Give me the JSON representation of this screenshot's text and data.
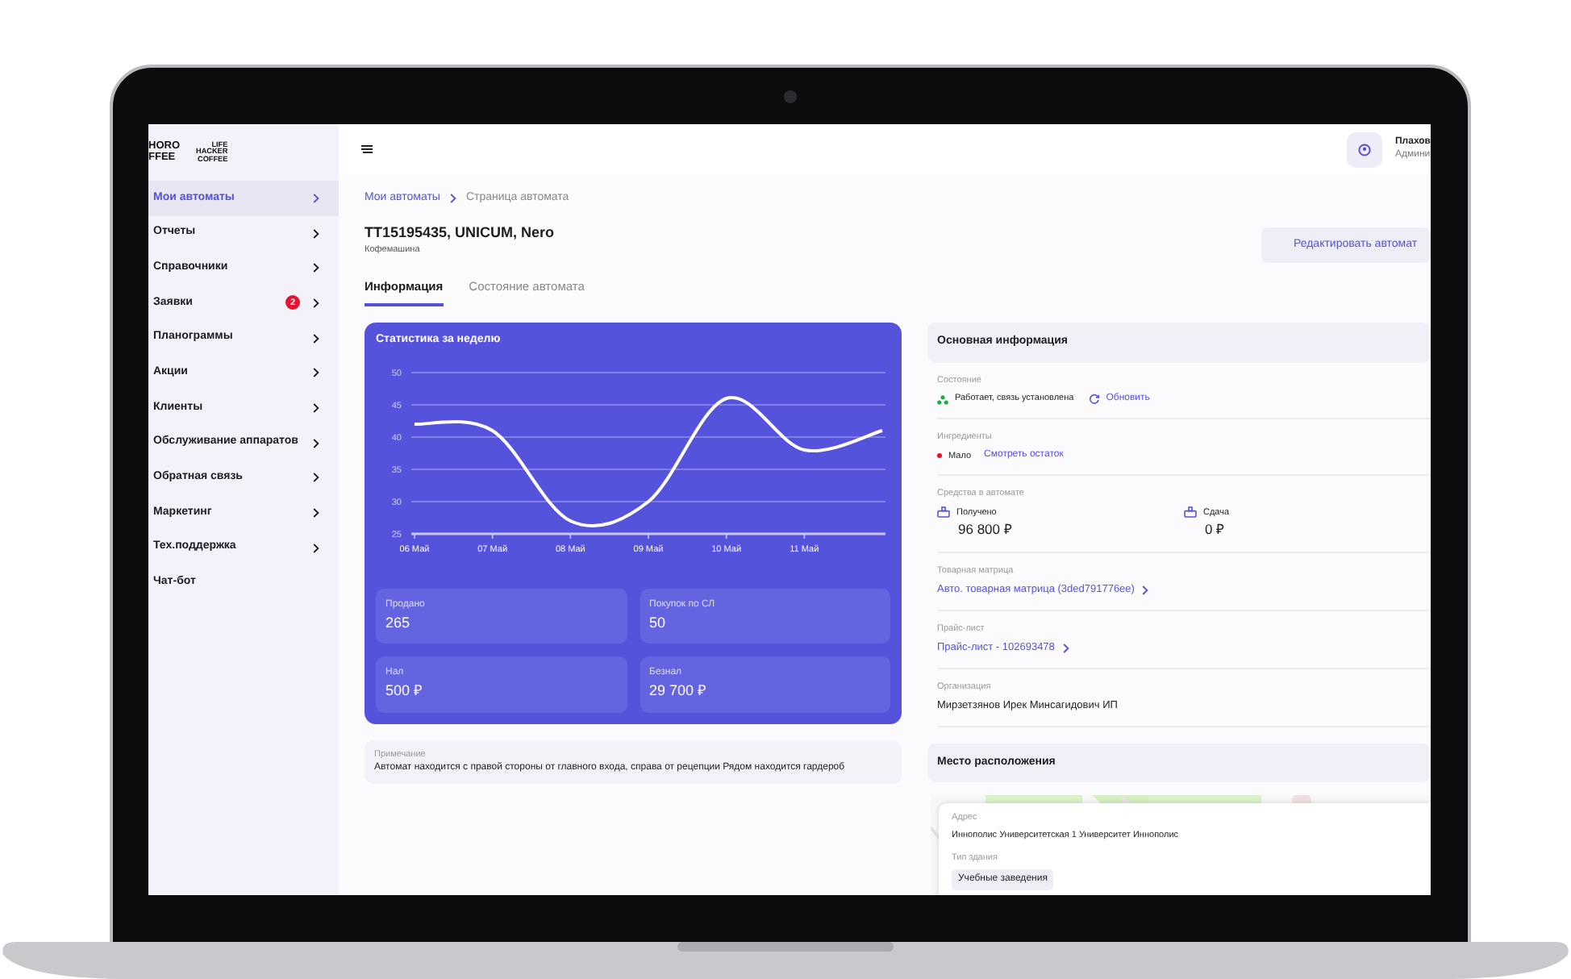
{
  "sidebar": {
    "logo": [
      {
        "text": "HORO\nFFEE"
      },
      {
        "text": "LIFE\nHACKER\nCOFFEE"
      }
    ],
    "items": [
      {
        "label": "Мои автоматы",
        "selected": true,
        "chevron": true
      },
      {
        "label": "Отчеты",
        "selected": false,
        "chevron": true
      },
      {
        "label": "Справочники",
        "selected": false,
        "chevron": true
      },
      {
        "label": "Заявки",
        "selected": false,
        "chevron": true,
        "badge": "2"
      },
      {
        "label": "Планограммы",
        "selected": false,
        "chevron": true
      },
      {
        "label": "Акции",
        "selected": false,
        "chevron": true
      },
      {
        "label": "Клиенты",
        "selected": false,
        "chevron": true
      },
      {
        "label": "Обслуживание аппаратов",
        "selected": false,
        "chevron": true
      },
      {
        "label": "Обратная связь",
        "selected": false,
        "chevron": true
      },
      {
        "label": "Маркетинг",
        "selected": false,
        "chevron": true
      },
      {
        "label": "Тех.поддержка",
        "selected": false,
        "chevron": true
      },
      {
        "label": "Чат-бот",
        "selected": false,
        "chevron": false
      }
    ]
  },
  "header": {
    "user_name": "Плахов",
    "user_role": "Админи"
  },
  "breadcrumb": [
    {
      "label": "Мои автоматы",
      "link": true
    },
    {
      "label": "Страница автомата",
      "link": false
    }
  ],
  "title": "TT15195435, UNICUM, Nero",
  "subtitle": "Кофемашина",
  "edit_button": "Редактировать автомат",
  "tabs": [
    {
      "label": "Информация",
      "selected": true
    },
    {
      "label": "Состояние автомата",
      "selected": false
    }
  ],
  "stats_card": {
    "title": "Статистика за неделю",
    "chart_data": {
      "type": "line",
      "categories": [
        "06 Май",
        "07 Май",
        "08 Май",
        "09 Май",
        "10 Май",
        "11 Май",
        null
      ],
      "series": [
        {
          "color": "#ffffff",
          "values": [
            42,
            41,
            27,
            30,
            46,
            38,
            41
          ]
        }
      ],
      "ylim": [
        25,
        50
      ],
      "yticks": [
        25,
        30,
        35,
        40,
        45,
        50
      ],
      "grid": true
    },
    "tiles": [
      {
        "label": "Продано",
        "value": "265"
      },
      {
        "label": "Покупок по СЛ",
        "value": "50"
      },
      {
        "label": "Нал",
        "value": "500 ₽"
      },
      {
        "label": "Безнал",
        "value": "29 700 ₽"
      }
    ]
  },
  "note": {
    "label": "Примечание",
    "text": "Автомат находится с правой стороны от главного входа, справа от рецепции Рядом находится гардероб"
  },
  "main_info": {
    "title": "Основная информация",
    "rows": [
      {
        "kind": "status",
        "label": "Состояние",
        "value": "Работает, связь установлена",
        "link": "Обновить"
      },
      {
        "kind": "level",
        "label": "Ингредиенты",
        "value": "Мало",
        "color": "#e8112d",
        "link": "Смотреть остаток"
      },
      {
        "kind": "money",
        "label": "Средства в автомате",
        "items": [
          {
            "label": "Получено",
            "value": "96 800 ₽"
          },
          {
            "label": "Сдача",
            "value": "0 ₽"
          }
        ]
      },
      {
        "kind": "link",
        "label": "Товарная матрица",
        "value": "Авто. товарная матрица (3ded791776ee)"
      },
      {
        "kind": "link",
        "label": "Прайс-лист",
        "value": "Прайс-лист - 102693478"
      },
      {
        "kind": "text",
        "label": "Организация",
        "value": "Мирзетзянов Ирек Минсагидович ИП"
      }
    ]
  },
  "location": {
    "title": "Место расположения",
    "address_label": "Адрес",
    "address": "Иннополис Университетская 1 Университет Иннополис",
    "building_label": "Тип здания",
    "building": "Учебные заведения"
  }
}
